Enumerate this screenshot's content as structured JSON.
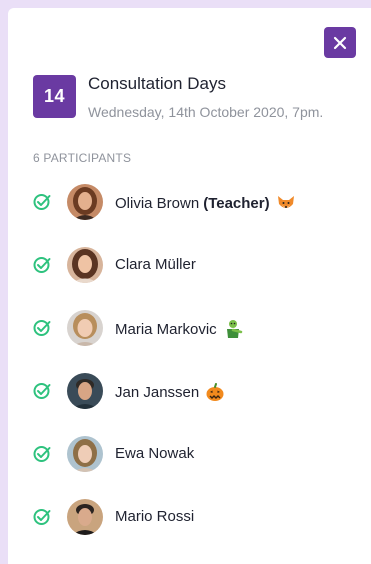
{
  "dialog": {
    "close_icon": "close-icon",
    "accent_color": "#6a3aa2"
  },
  "event": {
    "day_number": "14",
    "title": "Consultation Days",
    "datetime": "Wednesday, 14th October 2020, 7pm."
  },
  "participants_header": "6 PARTICIPANTS",
  "participants": [
    {
      "name": "Olivia Brown",
      "role": "(Teacher)",
      "emoji": "fox",
      "avatar_hair": "#6b3b22",
      "avatar_skin": "#e3b08e",
      "avatar_bg": "#c58a66"
    },
    {
      "name": "Clara Müller",
      "role": "",
      "emoji": "",
      "avatar_hair": "#5a3422",
      "avatar_skin": "#efc3a4",
      "avatar_bg": "#d7b49b"
    },
    {
      "name": "Maria Markovic",
      "role": "",
      "emoji": "zombie",
      "avatar_hair": "#b88e5c",
      "avatar_skin": "#f1ccb3",
      "avatar_bg": "#d8d3cf"
    },
    {
      "name": "Jan Janssen",
      "role": "",
      "emoji": "pumpkin",
      "avatar_hair": "#2f2a26",
      "avatar_skin": "#d7a585",
      "avatar_bg": "#3a4b58"
    },
    {
      "name": "Ewa Nowak",
      "role": "",
      "emoji": "",
      "avatar_hair": "#8e6f47",
      "avatar_skin": "#efcdb7",
      "avatar_bg": "#aec3cf"
    },
    {
      "name": "Mario Rossi",
      "role": "",
      "emoji": "",
      "avatar_hair": "#2b2420",
      "avatar_skin": "#d9aa8c",
      "avatar_bg": "#c9a47e"
    }
  ],
  "status_color": "#2ec27e"
}
